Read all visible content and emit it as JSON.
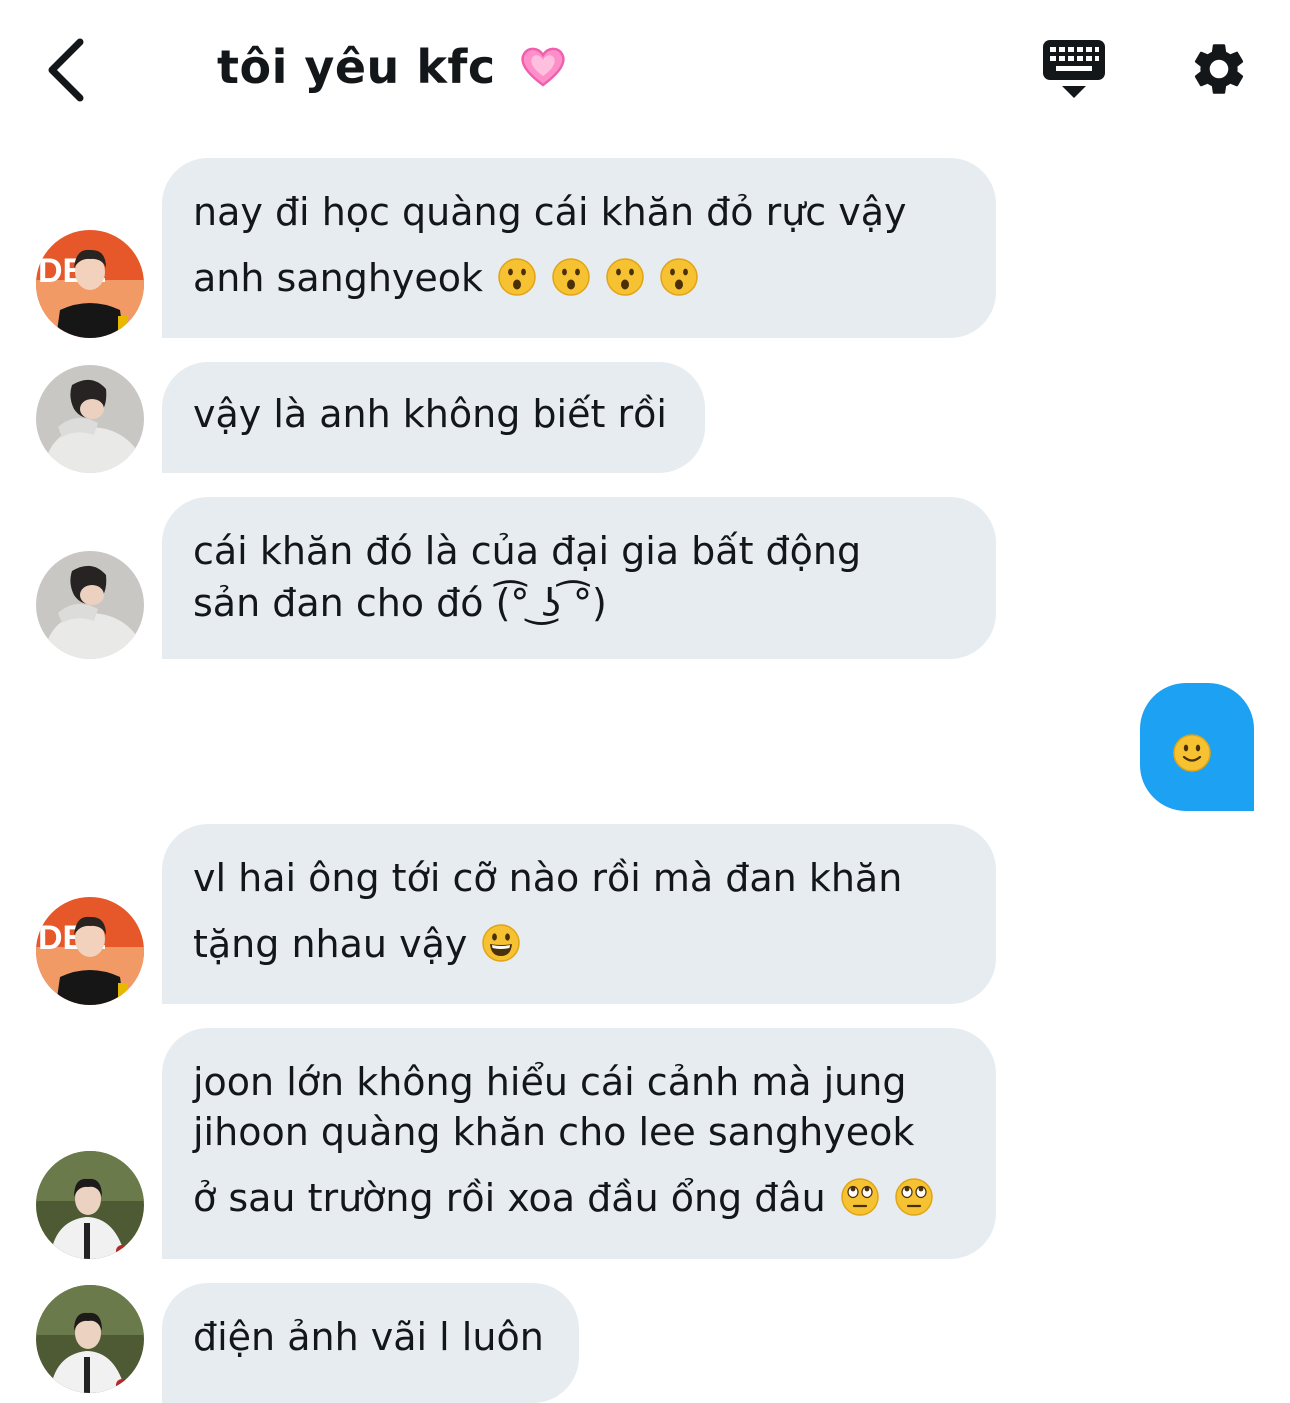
{
  "header": {
    "title": "tôi yêu kfc",
    "title_emoji": "pink-heart"
  },
  "messages": [
    {
      "avatar": "avatar-red-jersey",
      "lines": [
        "nay đi học quàng cái khăn đỏ rực vậy",
        "anh sanghyeok"
      ],
      "emojis": [
        "hushed-face",
        "hushed-face",
        "hushed-face",
        "hushed-face"
      ]
    },
    {
      "avatar": "avatar-gray-jacket",
      "lines": [
        "vậy là anh không biết rồi"
      ]
    },
    {
      "avatar": "avatar-gray-jacket",
      "lines": [
        " cái khăn đó là của đại gia bất động",
        "sản đan cho đó (͡° ͜ʖ ͡°)"
      ]
    },
    {
      "avatar": "avatar-red-jersey",
      "lines": [
        "vl hai ông tới cỡ nào rồi mà đan khăn",
        "tặng nhau vậy"
      ],
      "emojis": [
        "grinning-face"
      ]
    },
    {
      "avatar": "avatar-white-jacket",
      "lines": [
        "joon lớn không hiểu cái cảnh mà jung",
        "jihoon quàng khăn cho lee sanghyeok",
        "ở sau trường rồi xoa đầu ổng đâu"
      ],
      "emojis": [
        "rolling-eyes-face",
        "rolling-eyes-face"
      ]
    },
    {
      "avatar": "avatar-white-jacket",
      "lines": [
        "điện ảnh vãi l luôn"
      ]
    }
  ],
  "outgoing": [
    {
      "emoji": "slightly-smiling-face"
    }
  ],
  "colors": {
    "incoming_bubble": "#e6ecf0",
    "outgoing_bubble": "#1da1f2",
    "text": "#14171a"
  }
}
